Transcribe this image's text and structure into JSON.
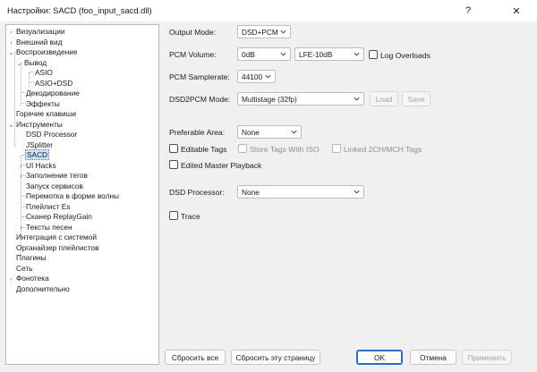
{
  "window": {
    "title": "Настройки: SACD (foo_input_sacd.dll)",
    "help_glyph": "?",
    "close_glyph": "✕"
  },
  "tree": {
    "items": [
      {
        "label": "Визуализации",
        "arrow": "›"
      },
      {
        "label": "Внешний вид",
        "arrow": "›"
      },
      {
        "label": "Воспроизведение",
        "arrow": "⌄"
      },
      {
        "label": "Вывод",
        "arrow": "⌄"
      },
      {
        "label": "ASIO",
        "arrow": ""
      },
      {
        "label": "ASIO+DSD",
        "arrow": ""
      },
      {
        "label": "Декодирование",
        "arrow": ""
      },
      {
        "label": "Эффекты",
        "arrow": ""
      },
      {
        "label": "Горячие клавиши",
        "arrow": ""
      },
      {
        "label": "Инструменты",
        "arrow": "⌄"
      },
      {
        "label": "DSD Processor",
        "arrow": ""
      },
      {
        "label": "JSplitter",
        "arrow": ""
      },
      {
        "label": "SACD",
        "arrow": ""
      },
      {
        "label": "UI Hacks",
        "arrow": "›"
      },
      {
        "label": "Заполнение тегов",
        "arrow": "›"
      },
      {
        "label": "Запуск сервисов",
        "arrow": ""
      },
      {
        "label": "Перемотка в форме волны",
        "arrow": ""
      },
      {
        "label": "Плейлист Es",
        "arrow": ""
      },
      {
        "label": "Сканер ReplayGain",
        "arrow": ""
      },
      {
        "label": "Тексты песен",
        "arrow": "›"
      },
      {
        "label": "Интеграция с системой",
        "arrow": ""
      },
      {
        "label": "Органайзер плейлистов",
        "arrow": ""
      },
      {
        "label": "Плагины",
        "arrow": ""
      },
      {
        "label": "Сеть",
        "arrow": ""
      },
      {
        "label": "Фонотека",
        "arrow": "›"
      },
      {
        "label": "Дополнительно",
        "arrow": ""
      }
    ]
  },
  "settings": {
    "output_mode": {
      "label": "Output Mode:",
      "value": "DSD+PCM"
    },
    "pcm_volume": {
      "label": "PCM Volume:",
      "value": "0dB",
      "lfe_value": "LFE-10dB"
    },
    "log_overloads": {
      "label": "Log Overloads",
      "checked": false
    },
    "pcm_samplerate": {
      "label": "PCM Samplerate:",
      "value": "44100"
    },
    "dsd2pcm_mode": {
      "label": "DSD2PCM Mode:",
      "value": "Multistage (32fp)"
    },
    "load_label": "Load",
    "save_label": "Save",
    "preferable_area": {
      "label": "Preferable Area:",
      "value": "None"
    },
    "editable_tags": {
      "label": "Editable Tags",
      "checked": false
    },
    "store_tags": {
      "label": "Store Tags With ISO",
      "checked": false
    },
    "linked_tags": {
      "label": "Linked 2CH/MCH Tags",
      "checked": false
    },
    "edited_master": {
      "label": "Edited Master Playback",
      "checked": false
    },
    "dsd_processor": {
      "label": "DSD Processor:",
      "value": "None"
    },
    "trace": {
      "label": "Trace",
      "checked": false
    }
  },
  "buttons": {
    "reset_all": "Сбросить все",
    "reset_page": "Сбросить эту страницу",
    "ok": "OK",
    "cancel": "Отмена",
    "apply": "Применить"
  },
  "colors": {
    "selection": "#cce4f7",
    "default_button_border": "#2b6cc4",
    "dialog_bg": "#f0f0f0"
  }
}
